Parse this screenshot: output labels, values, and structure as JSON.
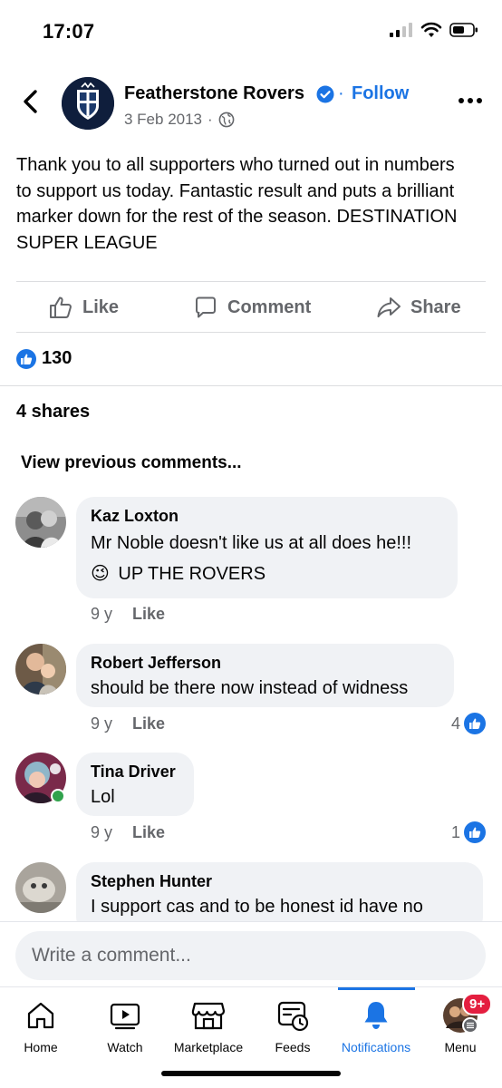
{
  "status": {
    "time": "17:07"
  },
  "post": {
    "page_name": "Featherstone Rovers",
    "follow_label": "Follow",
    "separator": "·",
    "date": "3 Feb 2013",
    "date_sep": "·",
    "text": "Thank you to all supporters who turned out in numbers to support us today. Fantastic result and puts a brilliant marker down for the rest of the season. DESTINATION SUPER LEAGUE"
  },
  "actions": {
    "like": "Like",
    "comment": "Comment",
    "share": "Share"
  },
  "reactions": {
    "count": "130"
  },
  "shares_label": "4 shares",
  "view_previous": "View previous comments...",
  "comments": [
    {
      "name": "Kaz Loxton",
      "line1": "Mr Noble doesn't like us at all does he!!!",
      "line2": "UP THE ROVERS",
      "emoji": "😉",
      "age": "9 y",
      "like": "Like",
      "reactions": ""
    },
    {
      "name": "Robert Jefferson",
      "line1": "should be there now instead of widness",
      "age": "9 y",
      "like": "Like",
      "reactions": "4"
    },
    {
      "name": "Tina Driver",
      "line1": "Lol",
      "age": "9 y",
      "like": "Like",
      "reactions": "1"
    },
    {
      "name": "Stephen Hunter",
      "line1": "I support cas and to be honest id have no"
    }
  ],
  "composer": {
    "placeholder": "Write a comment..."
  },
  "tabs": [
    {
      "label": "Home"
    },
    {
      "label": "Watch"
    },
    {
      "label": "Marketplace"
    },
    {
      "label": "Feeds"
    },
    {
      "label": "Notifications"
    },
    {
      "label": "Menu"
    }
  ],
  "menu_badge": "9+",
  "colors": {
    "accent": "#1b74e4",
    "badge": "#e41e3f",
    "online": "#31a24c",
    "secondary_text": "#65676b"
  }
}
